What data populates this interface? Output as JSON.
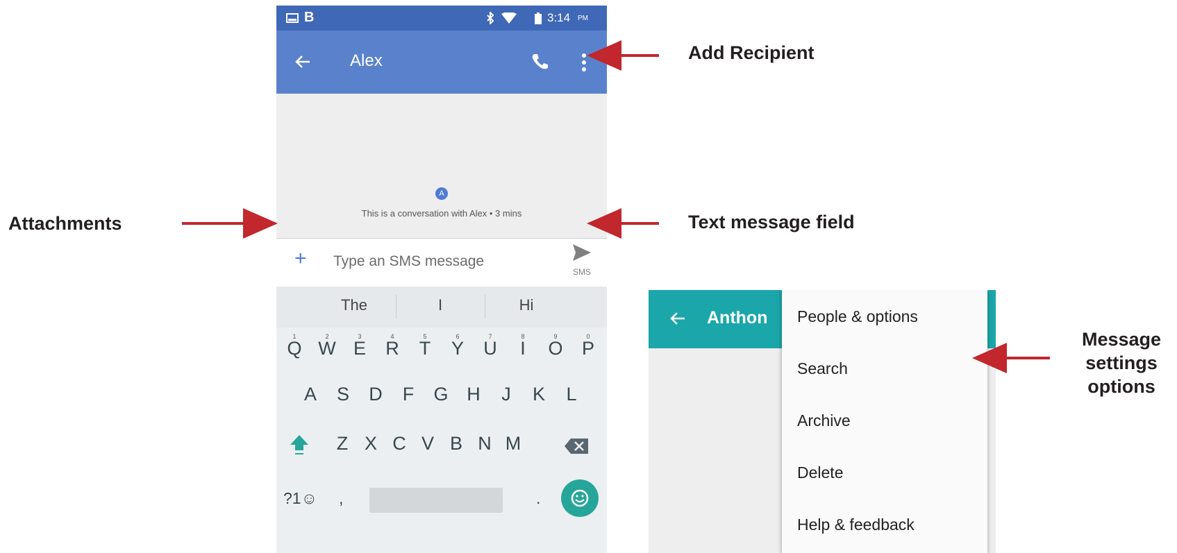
{
  "phone": {
    "status_bar": {
      "time": "3:14",
      "ampm": "PM",
      "left_icons": [
        "image-notification-icon",
        "b-app-icon"
      ],
      "right_icons": [
        "bluetooth-icon",
        "wifi-icon",
        "battery-icon"
      ]
    },
    "app_bar": {
      "back_icon": "arrow-back-icon",
      "title": "Alex",
      "call_icon": "phone-icon",
      "menu_icon": "more-vert-icon"
    },
    "conversation": {
      "avatar_letter": "A",
      "info_text": "This is a conversation with Alex • 3 mins"
    },
    "composer": {
      "attach_icon": "plus-icon",
      "placeholder": "Type an SMS message",
      "send_icon": "send-icon",
      "send_label": "SMS"
    },
    "keyboard": {
      "suggestions": [
        "The",
        "I",
        "Hi"
      ],
      "row1": [
        "Q",
        "W",
        "E",
        "R",
        "T",
        "Y",
        "U",
        "I",
        "O",
        "P"
      ],
      "row1_hints": [
        "1",
        "2",
        "3",
        "4",
        "5",
        "6",
        "7",
        "8",
        "9",
        "0"
      ],
      "row2": [
        "A",
        "S",
        "D",
        "F",
        "G",
        "H",
        "J",
        "K",
        "L"
      ],
      "row3": [
        "Z",
        "X",
        "C",
        "V",
        "B",
        "N",
        "M"
      ],
      "symbols_key": "?1☺",
      "comma_key": ",",
      "period_key": ".",
      "shift_icon": "shift-icon",
      "backspace_icon": "backspace-icon",
      "emoji_icon": "emoji-icon"
    }
  },
  "menu_screenshot": {
    "app_bar": {
      "back_icon": "arrow-back-icon",
      "title": "Anthon"
    },
    "menu_items": [
      "People & options",
      "Search",
      "Archive",
      "Delete",
      "Help & feedback"
    ]
  },
  "annotations": {
    "add_recipient": "Add Recipient",
    "attachments": "Attachments",
    "text_message_field": "Text message field",
    "message_settings": [
      "Message",
      "settings",
      "options"
    ],
    "arrow_color": "#c1272d"
  },
  "colors": {
    "status_bar": "#3f68b7",
    "app_bar": "#5a82cc",
    "accent_blue": "#4e7bd6",
    "teal": "#1ba6a9",
    "emoji_key": "#26a69a"
  }
}
